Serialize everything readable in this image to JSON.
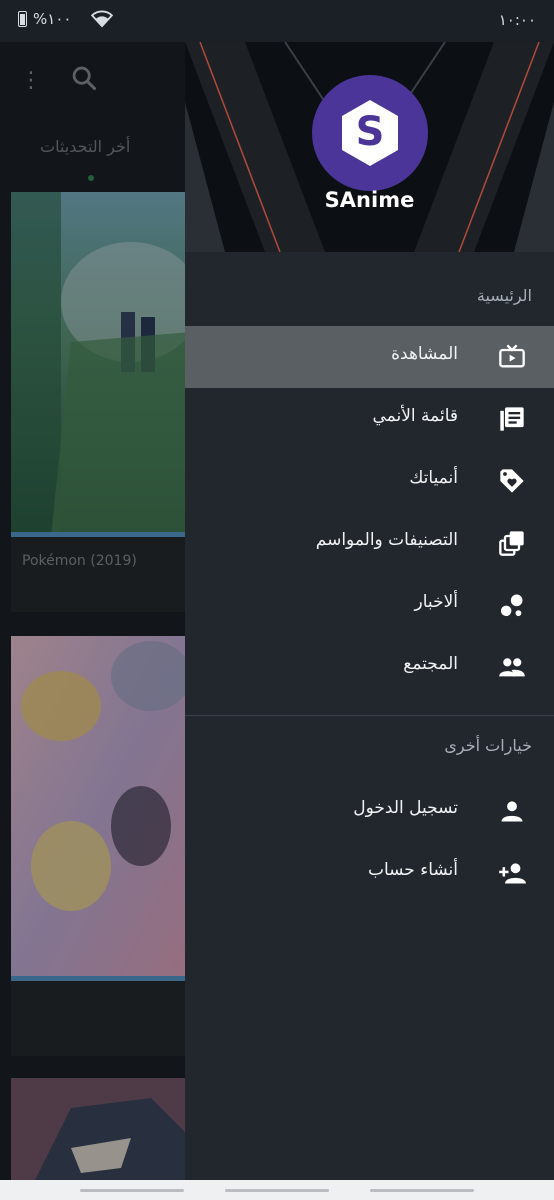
{
  "status_bar": {
    "battery": "%١٠٠",
    "time": "١٠:٠٠"
  },
  "background": {
    "tab_label": "أخر التحديثات",
    "cards": [
      {
        "title": "Pokémon (2019)"
      }
    ]
  },
  "drawer": {
    "app_name": "SAnime",
    "logo_letter": "S",
    "section_main": "الرئيسية",
    "main_items": [
      {
        "label": "المشاهدة",
        "icon": "tv-icon",
        "active": true
      },
      {
        "label": "قائمة الأنمي",
        "icon": "list-icon"
      },
      {
        "label": "أنمياتك",
        "icon": "tag-heart-icon"
      },
      {
        "label": "التصنيفات والمواسم",
        "icon": "collections-icon"
      },
      {
        "label": "ألاخبار",
        "icon": "bubbles-icon"
      },
      {
        "label": "المجتمع",
        "icon": "group-icon"
      }
    ],
    "section_other": "خيارات أخرى",
    "other_items": [
      {
        "label": "تسجيل الدخول",
        "icon": "person-icon"
      },
      {
        "label": "أنشاء حساب",
        "icon": "person-add-icon"
      }
    ]
  },
  "colors": {
    "accent": "#4b3599",
    "drawer_bg": "#22272d",
    "active_item": "#5a5f64"
  }
}
